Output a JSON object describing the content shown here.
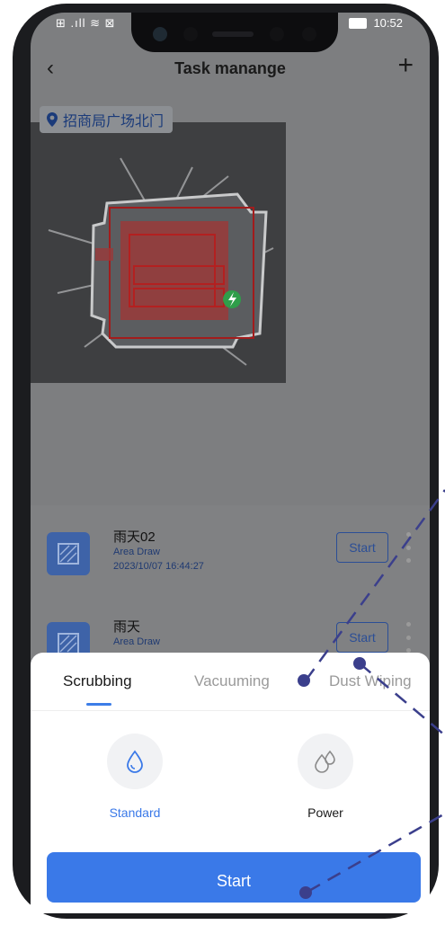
{
  "status_bar": {
    "left": "⊞ .ıll ≋ ⊠",
    "time": "10:52"
  },
  "header": {
    "title": "Task manange",
    "back_icon": "chevron-left-icon",
    "add_icon": "plus-icon"
  },
  "location": {
    "label": "招商局广场北门",
    "icon": "location-pin-icon"
  },
  "tasks": [
    {
      "name": "雨天02",
      "type": "Area Draw",
      "date": "2023/10/07 16:44:27",
      "start_label": "Start"
    },
    {
      "name": "雨天",
      "type": "Area Draw",
      "date": "",
      "start_label": "Start"
    }
  ],
  "sheet": {
    "tabs": [
      "Scrubbing",
      "Vacuuming",
      "Dust Wiping"
    ],
    "active_tab": "Scrubbing",
    "modes": [
      {
        "label": "Standard",
        "icon": "water-drop-icon",
        "selected": true
      },
      {
        "label": "Power",
        "icon": "water-drops-icon",
        "selected": false
      }
    ],
    "start_label": "Start"
  },
  "colors": {
    "accent": "#3a79e8",
    "dim_overlay": "#7d7e80",
    "annotation": "#3b3f8c"
  }
}
